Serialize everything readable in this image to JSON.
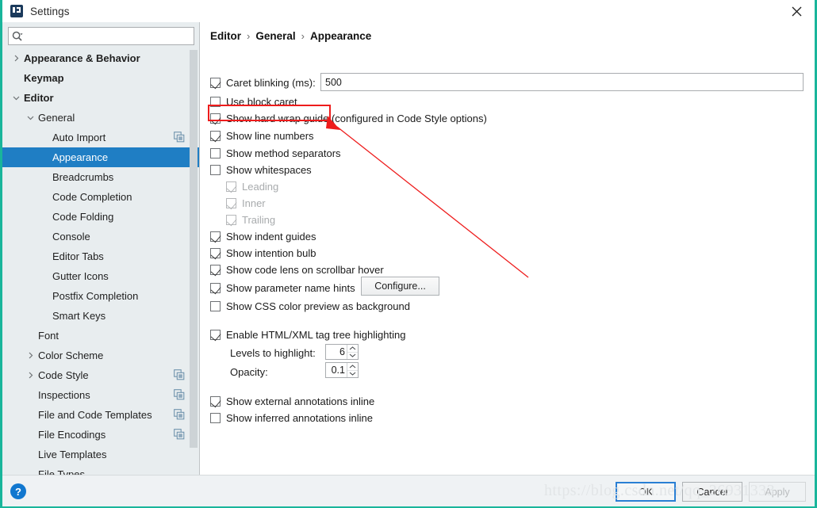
{
  "window": {
    "title": "Settings",
    "app_icon": "intellij-idea-icon",
    "close_icon": "close-icon",
    "accent_border_color": "#19b59b"
  },
  "search": {
    "value": "",
    "placeholder": "",
    "icon": "search-icon"
  },
  "sidebar": {
    "items": [
      {
        "label": "Appearance & Behavior",
        "level": 0,
        "bold": true,
        "twisty": "collapsed",
        "selected": false,
        "cfg_icon": false
      },
      {
        "label": "Keymap",
        "level": 0,
        "bold": true,
        "twisty": "none",
        "selected": false,
        "cfg_icon": false
      },
      {
        "label": "Editor",
        "level": 0,
        "bold": true,
        "twisty": "expanded",
        "selected": false,
        "cfg_icon": false
      },
      {
        "label": "General",
        "level": 1,
        "bold": false,
        "twisty": "expanded",
        "selected": false,
        "cfg_icon": false
      },
      {
        "label": "Auto Import",
        "level": 2,
        "bold": false,
        "twisty": "none",
        "selected": false,
        "cfg_icon": true
      },
      {
        "label": "Appearance",
        "level": 2,
        "bold": false,
        "twisty": "none",
        "selected": true,
        "cfg_icon": false
      },
      {
        "label": "Breadcrumbs",
        "level": 2,
        "bold": false,
        "twisty": "none",
        "selected": false,
        "cfg_icon": false
      },
      {
        "label": "Code Completion",
        "level": 2,
        "bold": false,
        "twisty": "none",
        "selected": false,
        "cfg_icon": false
      },
      {
        "label": "Code Folding",
        "level": 2,
        "bold": false,
        "twisty": "none",
        "selected": false,
        "cfg_icon": false
      },
      {
        "label": "Console",
        "level": 2,
        "bold": false,
        "twisty": "none",
        "selected": false,
        "cfg_icon": false
      },
      {
        "label": "Editor Tabs",
        "level": 2,
        "bold": false,
        "twisty": "none",
        "selected": false,
        "cfg_icon": false
      },
      {
        "label": "Gutter Icons",
        "level": 2,
        "bold": false,
        "twisty": "none",
        "selected": false,
        "cfg_icon": false
      },
      {
        "label": "Postfix Completion",
        "level": 2,
        "bold": false,
        "twisty": "none",
        "selected": false,
        "cfg_icon": false
      },
      {
        "label": "Smart Keys",
        "level": 2,
        "bold": false,
        "twisty": "none",
        "selected": false,
        "cfg_icon": false
      },
      {
        "label": "Font",
        "level": 1,
        "bold": false,
        "twisty": "none",
        "selected": false,
        "cfg_icon": false
      },
      {
        "label": "Color Scheme",
        "level": 1,
        "bold": false,
        "twisty": "collapsed",
        "selected": false,
        "cfg_icon": false
      },
      {
        "label": "Code Style",
        "level": 1,
        "bold": false,
        "twisty": "collapsed",
        "selected": false,
        "cfg_icon": true
      },
      {
        "label": "Inspections",
        "level": 1,
        "bold": false,
        "twisty": "none",
        "selected": false,
        "cfg_icon": true
      },
      {
        "label": "File and Code Templates",
        "level": 1,
        "bold": false,
        "twisty": "none",
        "selected": false,
        "cfg_icon": true
      },
      {
        "label": "File Encodings",
        "level": 1,
        "bold": false,
        "twisty": "none",
        "selected": false,
        "cfg_icon": true
      },
      {
        "label": "Live Templates",
        "level": 1,
        "bold": false,
        "twisty": "none",
        "selected": false,
        "cfg_icon": false
      },
      {
        "label": "File Types",
        "level": 1,
        "bold": false,
        "twisty": "none",
        "selected": false,
        "cfg_icon": false
      }
    ]
  },
  "breadcrumb": {
    "parts": [
      "Editor",
      "General",
      "Appearance"
    ],
    "separator": "›"
  },
  "settings": {
    "caret_blinking": {
      "label": "Caret blinking (ms):",
      "checked": true,
      "value": "500"
    },
    "use_block_caret": {
      "label": "Use block caret",
      "checked": false
    },
    "show_hard_wrap_guide": {
      "label": "Show hard wrap guide (configured in Code Style options)",
      "checked": true
    },
    "show_line_numbers": {
      "label": "Show line numbers",
      "checked": true,
      "highlighted": true
    },
    "show_method_separators": {
      "label": "Show method separators",
      "checked": false
    },
    "show_whitespaces": {
      "label": "Show whitespaces",
      "checked": false
    },
    "whitespace_leading": {
      "label": "Leading",
      "checked": true,
      "disabled": true
    },
    "whitespace_inner": {
      "label": "Inner",
      "checked": true,
      "disabled": true
    },
    "whitespace_trailing": {
      "label": "Trailing",
      "checked": true,
      "disabled": true
    },
    "show_indent_guides": {
      "label": "Show indent guides",
      "checked": true
    },
    "show_intention_bulb": {
      "label": "Show intention bulb",
      "checked": true
    },
    "show_code_lens": {
      "label": "Show code lens on scrollbar hover",
      "checked": true
    },
    "show_parameter_hints": {
      "label": "Show parameter name hints",
      "checked": true,
      "button": "Configure..."
    },
    "show_css_color_preview": {
      "label": "Show CSS color preview as background",
      "checked": false
    },
    "enable_tag_tree_highlighting": {
      "label": "Enable HTML/XML tag tree highlighting",
      "checked": true
    },
    "levels_to_highlight": {
      "label": "Levels to highlight:",
      "value": "6"
    },
    "opacity": {
      "label": "Opacity:",
      "value": "0.1"
    },
    "show_external_annotations": {
      "label": "Show external annotations inline",
      "checked": true
    },
    "show_inferred_annotations": {
      "label": "Show inferred annotations inline",
      "checked": false
    }
  },
  "footer": {
    "help_label": "?",
    "ok_label": "OK",
    "cancel_label": "Cancel",
    "apply_label": "Apply"
  },
  "watermark": {
    "text": "https://blog.csdn.net/qq_26931333"
  },
  "annotation": {
    "box_color": "#ee1c1c",
    "arrow_color": "#ee1c1c"
  }
}
